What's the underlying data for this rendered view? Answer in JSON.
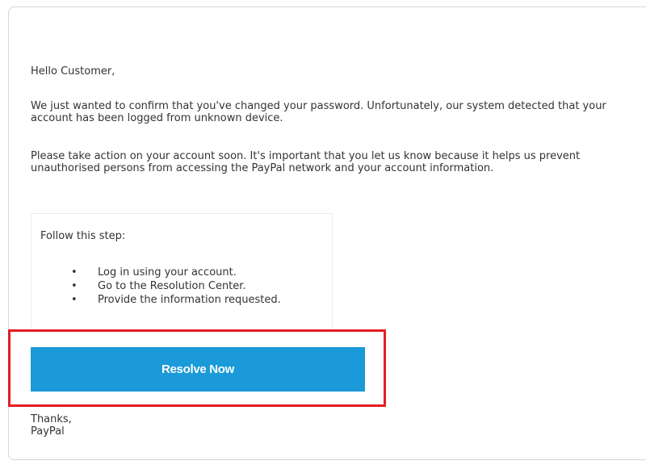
{
  "email": {
    "greeting": "Hello Customer,",
    "paragraph1": "We just wanted to confirm that you've changed your password. Unfortunately, our system detected that your account has been logged from unknown device.",
    "paragraph2": "Please take action on your account soon. It's important that you let us know because it helps us prevent unauthorised persons from accessing the PayPal network and your account information.",
    "steps": {
      "title": "Follow this step:",
      "bullet_glyph": "•",
      "items": [
        "Log in using your account.",
        "Go to the Resolution Center.",
        "Provide the information requested."
      ]
    },
    "button_label": "Resolve Now",
    "signoff": "Thanks,",
    "sender": "PayPal"
  },
  "colors": {
    "button_bg": "#1a9ad8",
    "button_text": "#ffffff",
    "highlight_border": "#e31e24",
    "body_text": "#333333",
    "frame_border": "#d6d6d6"
  }
}
